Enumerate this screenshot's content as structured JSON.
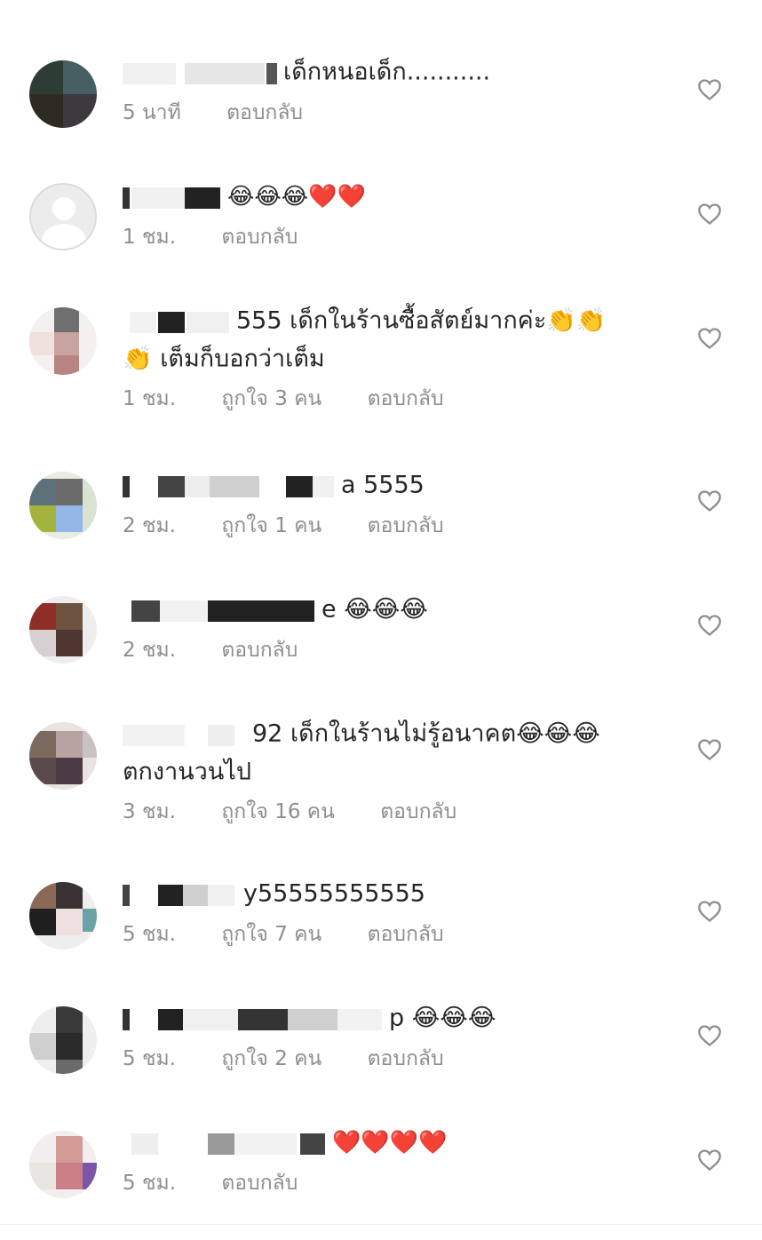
{
  "comments": [
    {
      "text": "เด็กหนอเด็ก...........",
      "lines": [
        "เด็กหนอเด็ก..........."
      ],
      "time": "5 นาที",
      "likes": "",
      "reply": "ตอบกลับ"
    },
    {
      "lines": [
        "😂😂😂❤️❤️"
      ],
      "time": "1 ชม.",
      "likes": "",
      "reply": "ตอบกลับ"
    },
    {
      "lines": [
        "555 เด็กในร้านซื้อสัตย์มากค่ะ👏👏",
        "👏 เต็มก็บอกว่าเต็ม"
      ],
      "time": "1 ชม.",
      "likes": "ถูกใจ 3 คน",
      "reply": "ตอบกลับ"
    },
    {
      "lines": [
        "a 5555"
      ],
      "time": "2 ชม.",
      "likes": "ถูกใจ 1 คน",
      "reply": "ตอบกลับ"
    },
    {
      "lines": [
        "e 😂😂😂"
      ],
      "time": "2 ชม.",
      "likes": "",
      "reply": "ตอบกลับ"
    },
    {
      "lines": [
        "92 เด็กในร้านไม่รู้อนาคต😂😂😂",
        "ตกงานวนไป"
      ],
      "time": "3 ชม.",
      "likes": "ถูกใจ 16 คน",
      "reply": "ตอบกลับ"
    },
    {
      "lines": [
        "y55555555555"
      ],
      "time": "5 ชม.",
      "likes": "ถูกใจ 7 คน",
      "reply": "ตอบกลับ"
    },
    {
      "lines": [
        "p 😂😂😂"
      ],
      "time": "5 ชม.",
      "likes": "ถูกใจ 2 คน",
      "reply": "ตอบกลับ"
    },
    {
      "lines": [
        "❤️❤️❤️❤️"
      ],
      "time": "5 ชม.",
      "likes": "",
      "reply": "ตอบกลับ"
    }
  ],
  "icons": {
    "like": "heart-outline-icon",
    "avatar_default": "default-user-icon"
  },
  "colors": {
    "text": "#262626",
    "meta": "#8e8e8e",
    "heart": "#8e8e8e"
  }
}
